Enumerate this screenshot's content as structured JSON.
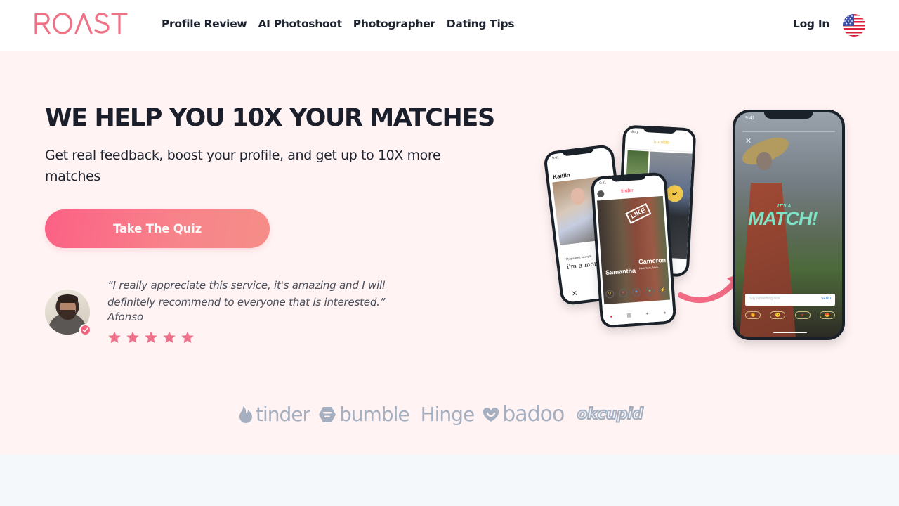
{
  "header": {
    "logo_text": "ROAST",
    "nav": [
      {
        "label": "Profile Review"
      },
      {
        "label": "AI Photoshoot"
      },
      {
        "label": "Photographer"
      },
      {
        "label": "Dating Tips"
      }
    ],
    "login_label": "Log In",
    "language_flag": "us-flag-icon"
  },
  "hero": {
    "title": "WE HELP YOU 10X YOUR MATCHES",
    "subtitle": "Get real feedback, boost your profile, and get up to 10X more matches",
    "cta_label": "Take The Quiz",
    "testimonial": {
      "quote": "“I really appreciate this service, it's amazing and I will definitely recommend to everyone that is interested.”",
      "author": "Afonso",
      "rating": 5,
      "rating_max": 5
    },
    "phones": {
      "bumble": {
        "time": "9:41",
        "app": "bumble"
      },
      "hinge": {
        "time": "9:41",
        "name": "Kaitlin",
        "prompt_label": "My greatest strength",
        "prompt_answer": "i'm a morn"
      },
      "tinder": {
        "time": "9:41",
        "app": "tinder",
        "stamp": "LIKE",
        "card1_name": "Samantha",
        "card2_name": "Cameron",
        "card2_info": "New York, New..."
      },
      "match": {
        "time": "9:41",
        "small": "IT'S A",
        "big": "MATCH!",
        "input_placeholder": "Say something nice",
        "send_label": "SEND"
      }
    }
  },
  "platforms": [
    {
      "name": "tinder"
    },
    {
      "name": "bumble"
    },
    {
      "name": "Hinge"
    },
    {
      "name": "badoo"
    },
    {
      "name": "okcupid"
    }
  ],
  "colors": {
    "brand": "#ef6f86",
    "hero_bg": "#fff3f3",
    "star": "#f0708a",
    "logo_gray": "#a5afbf"
  }
}
